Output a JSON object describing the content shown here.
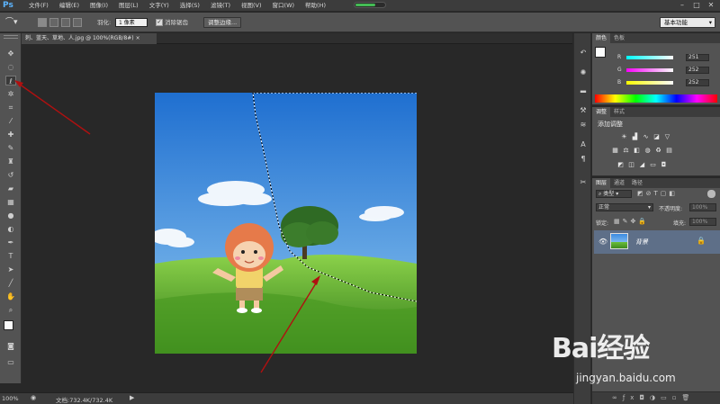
{
  "app": {
    "logo": "Ps"
  },
  "menu": [
    "文件(F)",
    "编辑(E)",
    "图像(I)",
    "图层(L)",
    "文字(Y)",
    "选择(S)",
    "滤镜(T)",
    "视图(V)",
    "窗口(W)",
    "帮助(H)"
  ],
  "window_buttons": {
    "minimize": "–",
    "maximize": "□",
    "close": "✕"
  },
  "progress": 0.7,
  "options": {
    "feather_label": "羽化:",
    "feather_value": "1 像素",
    "antialias_label": "消除锯齿",
    "antialias_checked": "✓",
    "refine_edge_button": "调整边缘...",
    "workspace": "基本功能"
  },
  "document": {
    "tab_label": "刺、蓝天、草地、人.jpg @ 100%(RGB/8#)",
    "tab_close": "×"
  },
  "status": {
    "zoom": "100%",
    "doc_size": "文档:732.4K/732.4K"
  },
  "color_panel": {
    "tabs": [
      "颜色",
      "色板"
    ],
    "channels": [
      {
        "label": "R",
        "value": "251"
      },
      {
        "label": "G",
        "value": "252"
      },
      {
        "label": "B",
        "value": "252"
      }
    ]
  },
  "adjustments_panel": {
    "tabs": [
      "调整",
      "样式"
    ],
    "title": "添加调整"
  },
  "layers_panel": {
    "tabs": [
      "图层",
      "通道",
      "路径"
    ],
    "kind_label": "类型",
    "blend_mode": "正常",
    "opacity_label": "不透明度:",
    "opacity_value": "100%",
    "lock_label": "锁定:",
    "fill_label": "填充:",
    "fill_value": "100%",
    "layers": [
      {
        "name": "背景"
      }
    ]
  },
  "watermark": {
    "logo": "Bai经验",
    "url": "jingyan.baidu.com"
  },
  "colors": {
    "accent": "#5cb5ff",
    "layer_selected": "#5e6f88",
    "annotation_arrow": "#b01010"
  }
}
